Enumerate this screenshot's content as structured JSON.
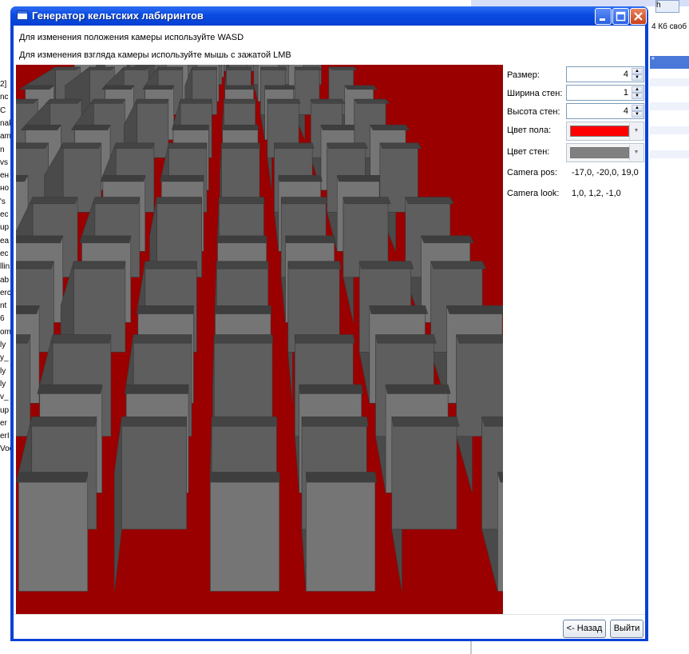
{
  "window": {
    "title": "Генератор кельтских лабиринтов",
    "controls": {
      "minimize": "minimize-icon",
      "maximize": "maximize-icon",
      "close": "close-icon"
    }
  },
  "hints": {
    "move": "Для изменения положения камеры используйте WASD",
    "look": "Для изменения взгляда камеры используйте мышь с зажатой LMB"
  },
  "settings": {
    "size": {
      "label": "Размер:",
      "value": "4"
    },
    "wall_width": {
      "label": "Ширина стен:",
      "value": "1"
    },
    "wall_height": {
      "label": "Высота стен:",
      "value": "4"
    },
    "floor_color": {
      "label": "Цвет пола:",
      "color": "#ff0000"
    },
    "wall_color": {
      "label": "Цвет стен:",
      "color": "#808080"
    }
  },
  "camera": {
    "pos_label": "Camera pos:",
    "pos_value": "-17,0, -20,0, 19,0",
    "look_label": "Camera look:",
    "look_value": "1,0, 1,2, -1,0"
  },
  "footer": {
    "back_label": "<- Назад",
    "exit_label": "Выйти"
  },
  "background": {
    "left_fragments": [
      "2]",
      "nc",
      "C",
      "nak",
      "am",
      "n",
      "vs",
      "ен",
      "но",
      "'s",
      "ec",
      "up",
      "ea",
      "ec",
      "llin",
      "ab",
      "erc",
      "nt",
      "6",
      "om",
      "ly",
      "y_",
      "ly",
      "ly",
      "v_",
      "up",
      "er",
      "erI",
      "Voc"
    ],
    "right_top": "4 Кб своб",
    "right_blue": "*",
    "user_button": "h"
  },
  "scene": {
    "floor_color": "#9a0000",
    "wall_color": "#6e6e6e"
  }
}
